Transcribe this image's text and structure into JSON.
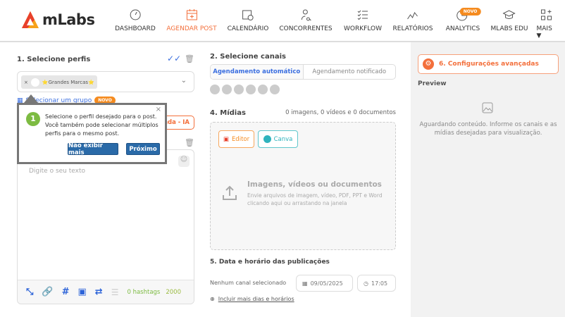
{
  "header": {
    "logo": "mLabs",
    "nav": [
      {
        "label": "DASHBOARD",
        "icon": "gauge-icon"
      },
      {
        "label": "AGENDAR POST",
        "icon": "calendar-plus-icon",
        "active": true
      },
      {
        "label": "CALENDÁRIO",
        "icon": "calendar-clock-icon"
      },
      {
        "label": "CONCORRENTES",
        "icon": "user-search-icon"
      },
      {
        "label": "WORKFLOW",
        "icon": "checklist-icon"
      },
      {
        "label": "RELATÓRIOS",
        "icon": "line-chart-icon"
      },
      {
        "label": "ANALYTICS",
        "icon": "pie-chart-icon",
        "badge": "NOVO"
      },
      {
        "label": "MLABS EDU",
        "icon": "graduation-cap-icon"
      },
      {
        "label": "MAIS ▼",
        "icon": "grid-plus-icon"
      }
    ]
  },
  "profiles": {
    "title": "1. Selecione perfis",
    "chip": "⭐Grandes Marcas⭐",
    "group_link": "Selecionar um grupo",
    "group_badge": "NOVO"
  },
  "caption": {
    "ia_button": "nda - IA",
    "placeholder": "Digite o seu texto",
    "hashtags": "0 hashtags",
    "char_count": "2000"
  },
  "tooltip": {
    "step": "1",
    "text": "Selecione o perfil desejado para o post. Você também pode selecionar múltiplos perfis para o mesmo post.",
    "dismiss": "Não exibir mais",
    "next": "Próximo"
  },
  "channels": {
    "title": "2. Selecione canais",
    "tabs": [
      "Agendamento automático",
      "Agendamento notificado"
    ],
    "icons": [
      "instagram-icon",
      "instagram-outline-icon",
      "instagram-stories-icon",
      "facebook-icon",
      "facebook-outline-icon",
      "instagram-reels-icon"
    ]
  },
  "media": {
    "title": "4. Mídias",
    "counts": "0 imagens, 0 vídeos e 0 documentos",
    "editor": "Editor",
    "canva": "Canva",
    "drop_title": "Imagens, vídeos ou documentos",
    "drop_text": "Envie arquivos de imagem, vídeo, PDF, PPT e Word clicando aqui ou arrastando na janela"
  },
  "schedule": {
    "title": "5. Data e horário das publicações",
    "no_channel": "Nenhum canal selecionado",
    "date": "09/05/2025",
    "time": "17:05",
    "add_more": "Incluir mais dias e horários"
  },
  "right": {
    "advanced": "6. Configurações avançadas",
    "preview": "Preview",
    "waiting": "Aguardando conteúdo. Informe os canais e as mídias desejadas para visualização."
  },
  "colors": {
    "accent": "#f36f3b",
    "blue": "#2a6aa8",
    "link": "#3b6fe0",
    "green": "#7dbb42"
  }
}
